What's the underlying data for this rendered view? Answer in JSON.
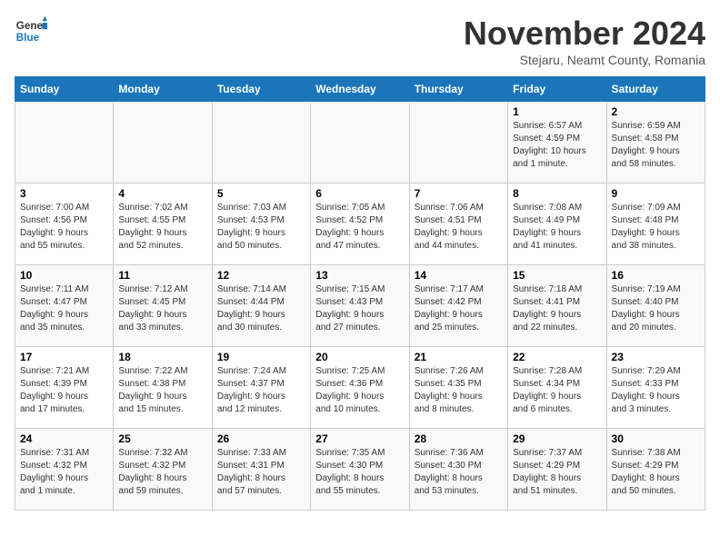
{
  "header": {
    "logo_line1": "General",
    "logo_line2": "Blue",
    "month": "November 2024",
    "location": "Stejaru, Neamt County, Romania"
  },
  "weekdays": [
    "Sunday",
    "Monday",
    "Tuesday",
    "Wednesday",
    "Thursday",
    "Friday",
    "Saturday"
  ],
  "weeks": [
    [
      {
        "day": "",
        "info": ""
      },
      {
        "day": "",
        "info": ""
      },
      {
        "day": "",
        "info": ""
      },
      {
        "day": "",
        "info": ""
      },
      {
        "day": "",
        "info": ""
      },
      {
        "day": "1",
        "info": "Sunrise: 6:57 AM\nSunset: 4:59 PM\nDaylight: 10 hours\nand 1 minute."
      },
      {
        "day": "2",
        "info": "Sunrise: 6:59 AM\nSunset: 4:58 PM\nDaylight: 9 hours\nand 58 minutes."
      }
    ],
    [
      {
        "day": "3",
        "info": "Sunrise: 7:00 AM\nSunset: 4:56 PM\nDaylight: 9 hours\nand 55 minutes."
      },
      {
        "day": "4",
        "info": "Sunrise: 7:02 AM\nSunset: 4:55 PM\nDaylight: 9 hours\nand 52 minutes."
      },
      {
        "day": "5",
        "info": "Sunrise: 7:03 AM\nSunset: 4:53 PM\nDaylight: 9 hours\nand 50 minutes."
      },
      {
        "day": "6",
        "info": "Sunrise: 7:05 AM\nSunset: 4:52 PM\nDaylight: 9 hours\nand 47 minutes."
      },
      {
        "day": "7",
        "info": "Sunrise: 7:06 AM\nSunset: 4:51 PM\nDaylight: 9 hours\nand 44 minutes."
      },
      {
        "day": "8",
        "info": "Sunrise: 7:08 AM\nSunset: 4:49 PM\nDaylight: 9 hours\nand 41 minutes."
      },
      {
        "day": "9",
        "info": "Sunrise: 7:09 AM\nSunset: 4:48 PM\nDaylight: 9 hours\nand 38 minutes."
      }
    ],
    [
      {
        "day": "10",
        "info": "Sunrise: 7:11 AM\nSunset: 4:47 PM\nDaylight: 9 hours\nand 35 minutes."
      },
      {
        "day": "11",
        "info": "Sunrise: 7:12 AM\nSunset: 4:45 PM\nDaylight: 9 hours\nand 33 minutes."
      },
      {
        "day": "12",
        "info": "Sunrise: 7:14 AM\nSunset: 4:44 PM\nDaylight: 9 hours\nand 30 minutes."
      },
      {
        "day": "13",
        "info": "Sunrise: 7:15 AM\nSunset: 4:43 PM\nDaylight: 9 hours\nand 27 minutes."
      },
      {
        "day": "14",
        "info": "Sunrise: 7:17 AM\nSunset: 4:42 PM\nDaylight: 9 hours\nand 25 minutes."
      },
      {
        "day": "15",
        "info": "Sunrise: 7:18 AM\nSunset: 4:41 PM\nDaylight: 9 hours\nand 22 minutes."
      },
      {
        "day": "16",
        "info": "Sunrise: 7:19 AM\nSunset: 4:40 PM\nDaylight: 9 hours\nand 20 minutes."
      }
    ],
    [
      {
        "day": "17",
        "info": "Sunrise: 7:21 AM\nSunset: 4:39 PM\nDaylight: 9 hours\nand 17 minutes."
      },
      {
        "day": "18",
        "info": "Sunrise: 7:22 AM\nSunset: 4:38 PM\nDaylight: 9 hours\nand 15 minutes."
      },
      {
        "day": "19",
        "info": "Sunrise: 7:24 AM\nSunset: 4:37 PM\nDaylight: 9 hours\nand 12 minutes."
      },
      {
        "day": "20",
        "info": "Sunrise: 7:25 AM\nSunset: 4:36 PM\nDaylight: 9 hours\nand 10 minutes."
      },
      {
        "day": "21",
        "info": "Sunrise: 7:26 AM\nSunset: 4:35 PM\nDaylight: 9 hours\nand 8 minutes."
      },
      {
        "day": "22",
        "info": "Sunrise: 7:28 AM\nSunset: 4:34 PM\nDaylight: 9 hours\nand 6 minutes."
      },
      {
        "day": "23",
        "info": "Sunrise: 7:29 AM\nSunset: 4:33 PM\nDaylight: 9 hours\nand 3 minutes."
      }
    ],
    [
      {
        "day": "24",
        "info": "Sunrise: 7:31 AM\nSunset: 4:32 PM\nDaylight: 9 hours\nand 1 minute."
      },
      {
        "day": "25",
        "info": "Sunrise: 7:32 AM\nSunset: 4:32 PM\nDaylight: 8 hours\nand 59 minutes."
      },
      {
        "day": "26",
        "info": "Sunrise: 7:33 AM\nSunset: 4:31 PM\nDaylight: 8 hours\nand 57 minutes."
      },
      {
        "day": "27",
        "info": "Sunrise: 7:35 AM\nSunset: 4:30 PM\nDaylight: 8 hours\nand 55 minutes."
      },
      {
        "day": "28",
        "info": "Sunrise: 7:36 AM\nSunset: 4:30 PM\nDaylight: 8 hours\nand 53 minutes."
      },
      {
        "day": "29",
        "info": "Sunrise: 7:37 AM\nSunset: 4:29 PM\nDaylight: 8 hours\nand 51 minutes."
      },
      {
        "day": "30",
        "info": "Sunrise: 7:38 AM\nSunset: 4:29 PM\nDaylight: 8 hours\nand 50 minutes."
      }
    ]
  ]
}
